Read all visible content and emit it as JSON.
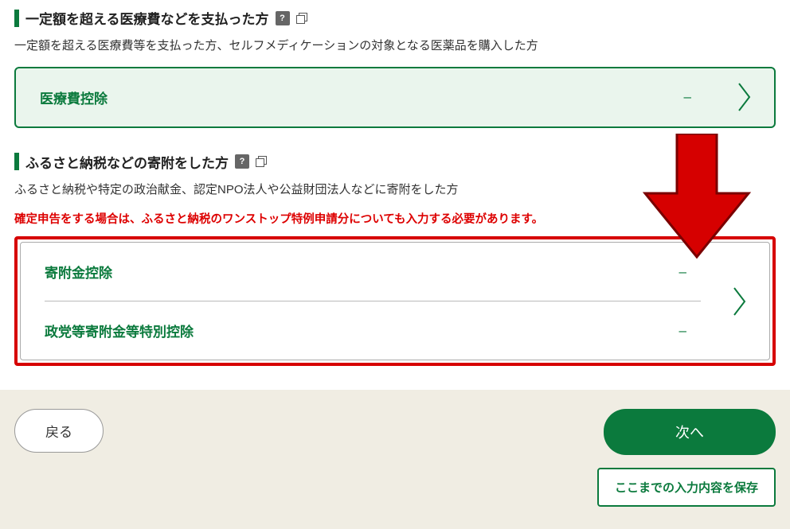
{
  "sections": {
    "medical": {
      "title": "一定額を超える医療費などを支払った方",
      "desc": "一定額を超える医療費等を支払った方、セルフメディケーションの対象となる医薬品を購入した方",
      "items": [
        {
          "label": "医療費控除",
          "value": "–"
        }
      ]
    },
    "donation": {
      "title": "ふるさと納税などの寄附をした方",
      "desc": "ふるさと納税や特定の政治献金、認定NPO法人や公益財団法人などに寄附をした方",
      "warning": "確定申告をする場合は、ふるさと納税のワンストップ特例申請分についても入力する必要があります。",
      "items": [
        {
          "label": "寄附金控除",
          "value": "–"
        },
        {
          "label": "政党等寄附金等特別控除",
          "value": "–"
        }
      ]
    }
  },
  "buttons": {
    "back": "戻る",
    "next": "次へ",
    "save": "ここまでの入力内容を保存"
  },
  "icons": {
    "help": "?"
  }
}
